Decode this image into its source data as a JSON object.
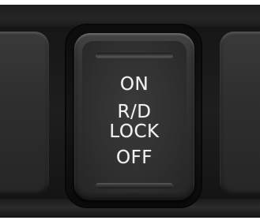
{
  "switch": {
    "lines": [
      "ON",
      "R/D",
      "LOCK",
      "OFF"
    ]
  },
  "colors": {
    "panel": "#1a1a1a",
    "switch_face": "#303030",
    "label": "#f2f2f2"
  }
}
